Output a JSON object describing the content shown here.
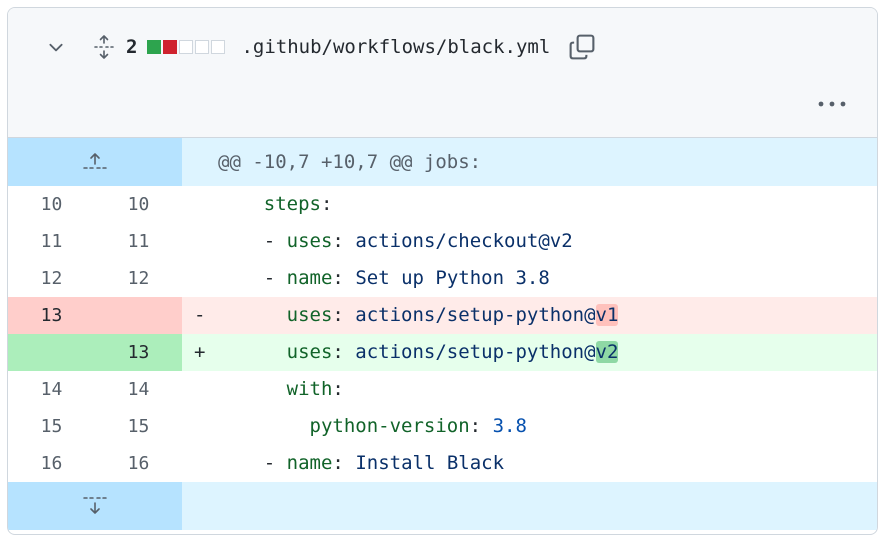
{
  "file": {
    "diffstat_count": "2",
    "diffstat_blocks": [
      "add",
      "del",
      "neutral",
      "neutral",
      "neutral"
    ],
    "path": ".github/workflows/black.yml"
  },
  "colors": {
    "add_block": "#2da44e",
    "del_block": "#cf222e",
    "neutral_block": "#d0d7de"
  },
  "icons": {
    "collapse": "chevron-down-icon",
    "expand_all": "unfold-icon",
    "copy": "copy-icon",
    "more": "kebab-horizontal-icon",
    "expand_up": "fold-up-icon",
    "expand_down": "fold-down-icon"
  },
  "hunk_header": "@@ -10,7 +10,7 @@ jobs:",
  "lines": [
    {
      "type": "ctx",
      "old": "10",
      "new": "10",
      "marker": "",
      "indent": "    ",
      "parts": [
        {
          "c": "k",
          "t": "steps"
        },
        {
          "c": "",
          "t": ":"
        }
      ]
    },
    {
      "type": "ctx",
      "old": "11",
      "new": "11",
      "marker": "",
      "indent": "    ",
      "parts": [
        {
          "c": "",
          "t": "- "
        },
        {
          "c": "k",
          "t": "uses"
        },
        {
          "c": "",
          "t": ": "
        },
        {
          "c": "v",
          "t": "actions/checkout@v2"
        }
      ]
    },
    {
      "type": "ctx",
      "old": "12",
      "new": "12",
      "marker": "",
      "indent": "    ",
      "parts": [
        {
          "c": "",
          "t": "- "
        },
        {
          "c": "k",
          "t": "name"
        },
        {
          "c": "",
          "t": ": "
        },
        {
          "c": "v",
          "t": "Set up Python 3.8"
        }
      ]
    },
    {
      "type": "del",
      "old": "13",
      "new": "",
      "marker": "-",
      "indent": "      ",
      "parts": [
        {
          "c": "k",
          "t": "uses"
        },
        {
          "c": "",
          "t": ": "
        },
        {
          "c": "v",
          "t": "actions/setup-python@"
        },
        {
          "c": "v hl-del",
          "t": "v1"
        }
      ]
    },
    {
      "type": "add",
      "old": "",
      "new": "13",
      "marker": "+",
      "indent": "      ",
      "parts": [
        {
          "c": "k",
          "t": "uses"
        },
        {
          "c": "",
          "t": ": "
        },
        {
          "c": "v",
          "t": "actions/setup-python@"
        },
        {
          "c": "v hl-add",
          "t": "v2"
        }
      ]
    },
    {
      "type": "ctx",
      "old": "14",
      "new": "14",
      "marker": "",
      "indent": "      ",
      "parts": [
        {
          "c": "k",
          "t": "with"
        },
        {
          "c": "",
          "t": ":"
        }
      ]
    },
    {
      "type": "ctx",
      "old": "15",
      "new": "15",
      "marker": "",
      "indent": "        ",
      "parts": [
        {
          "c": "k",
          "t": "python-version"
        },
        {
          "c": "",
          "t": ": "
        },
        {
          "c": "n",
          "t": "3.8"
        }
      ]
    },
    {
      "type": "ctx",
      "old": "16",
      "new": "16",
      "marker": "",
      "indent": "    ",
      "parts": [
        {
          "c": "",
          "t": "- "
        },
        {
          "c": "k",
          "t": "name"
        },
        {
          "c": "",
          "t": ": "
        },
        {
          "c": "v",
          "t": "Install Black"
        }
      ]
    }
  ]
}
